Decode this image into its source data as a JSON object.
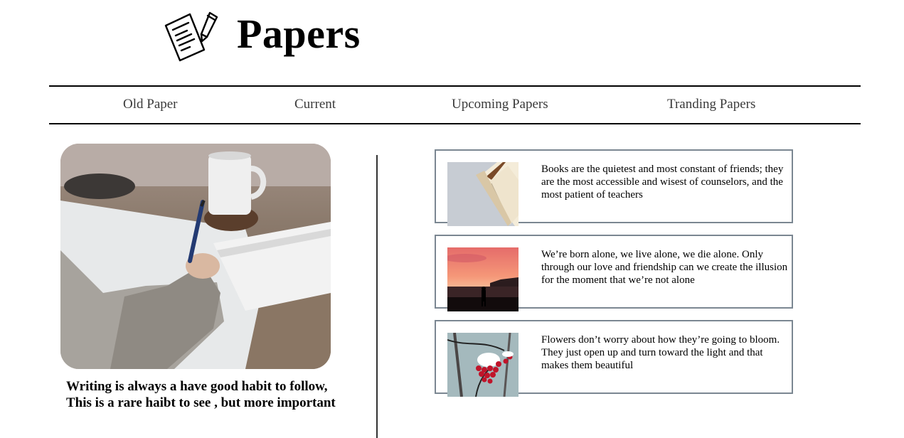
{
  "header": {
    "brand": "Papers",
    "logo_icon": "paper-pencil-icon"
  },
  "nav": {
    "items": [
      {
        "label": "Old Paper"
      },
      {
        "label": "Current"
      },
      {
        "label": "Upcoming Papers"
      },
      {
        "label": "Tranding Papers"
      }
    ]
  },
  "hero": {
    "image": "person-writing-in-notebook-photo",
    "caption": "Writing is always a have good habit to follow, This is a rare haibt to see , but more important"
  },
  "cards": [
    {
      "image": "open-book-photo",
      "text": "Books are the quietest and most constant of friends; they are the most accessible and wisest of counselors, and the most patient of teachers"
    },
    {
      "image": "sunset-silhouette-photo",
      "text": "We’re born alone, we live alone, we die alone. Only through our love and friendship can we create the illusion for the moment that we’re not alone"
    },
    {
      "image": "red-berries-snow-photo",
      "text": "Flowers don’t worry about how they’re going to bloom. They just open up and turn toward the light and that makes them beautiful"
    }
  ],
  "colors": {
    "card_border": "#7b8792",
    "divider": "#333333",
    "nav_text": "#3a3a3a"
  }
}
